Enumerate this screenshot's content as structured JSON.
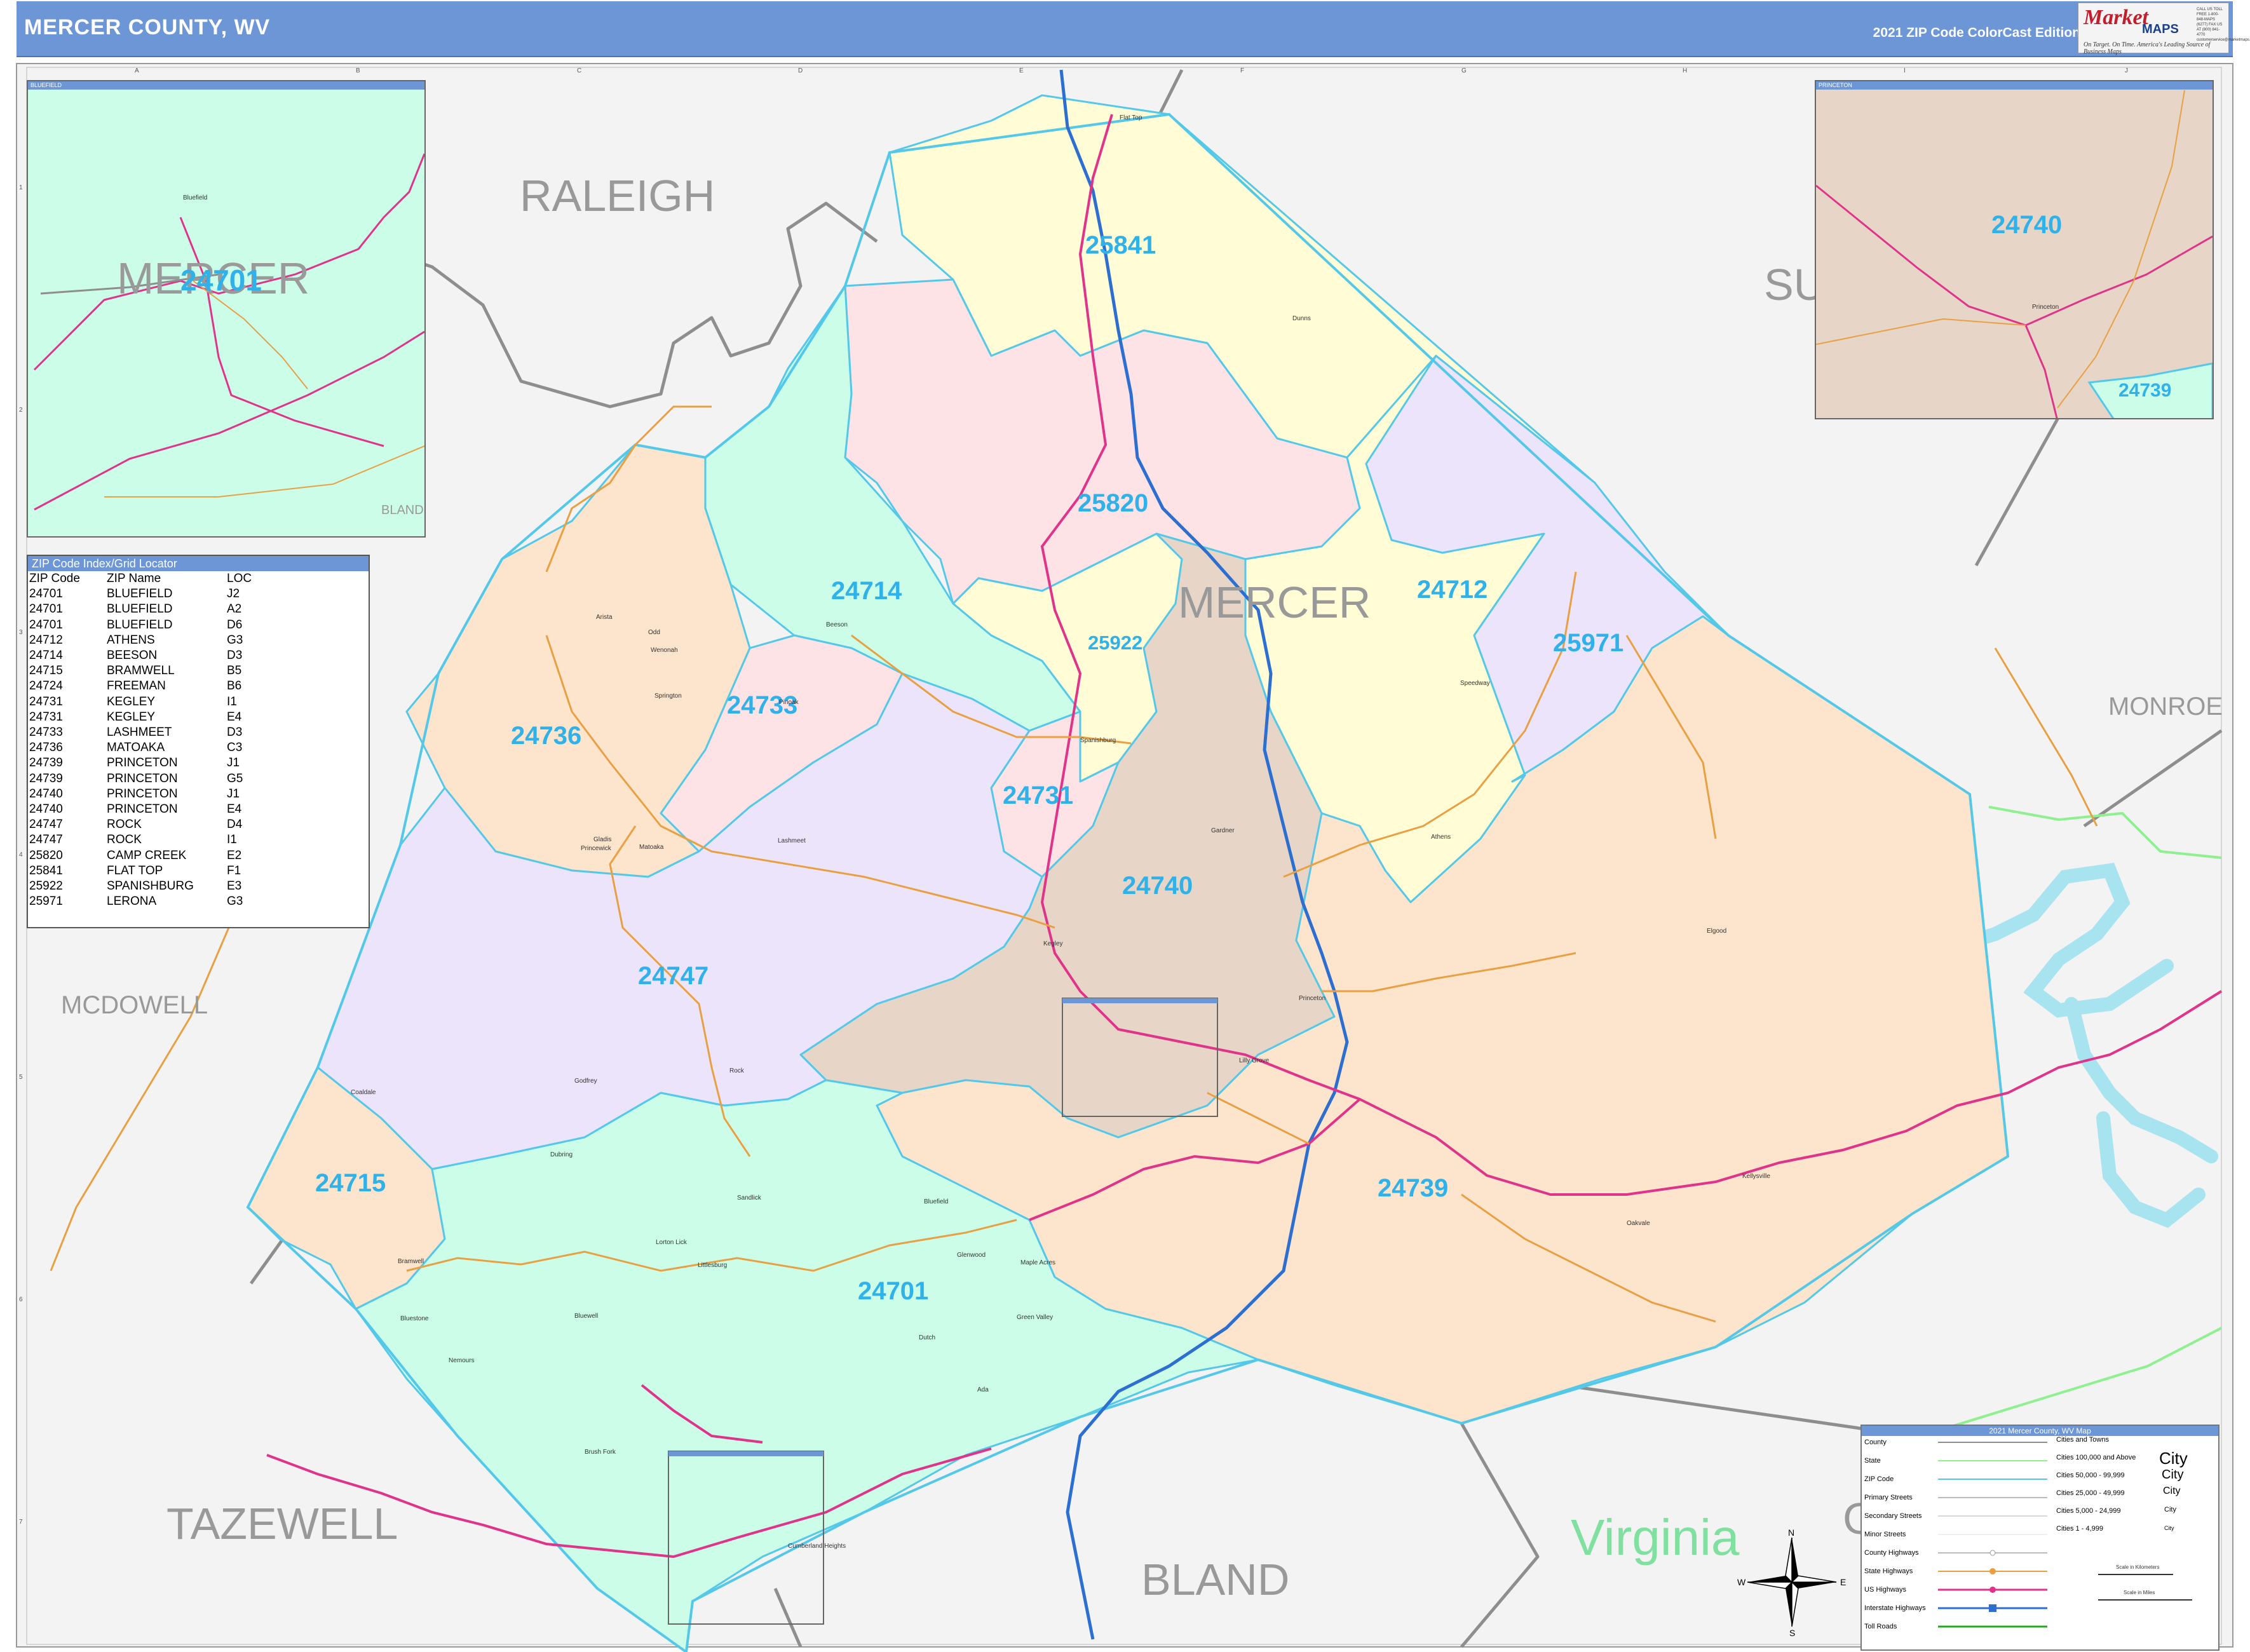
{
  "header": {
    "title": "MERCER COUNTY, WV",
    "edition": "2021 ZIP Code ColorCast Edition"
  },
  "logo": {
    "brand_market": "Market",
    "brand_maps": "MAPS",
    "tagline": "On Target. On Time. America's Leading Source of Business Maps",
    "contact": "CALL US TOLL FREE 1-800-848-MAPS (6277) FAX US AT (800) 841-4770 customerservice@marketmaps.com"
  },
  "colors": {
    "zip_label": "#2fb1ea",
    "zip_boundary": "#54c8e8",
    "county_boundary": "#8e8e8e",
    "us_highway": "#e0338a",
    "interstate": "#2c6fd0",
    "state_highway": "#e8a043",
    "water": "#a8e4f0",
    "virginia_label": "#7fe0a0"
  },
  "counties": {
    "raleigh": "RALEIGH",
    "summers": "SU",
    "monroe": "MONROE",
    "mcdowell": "MCDOWELL",
    "tazewell": "TAZEWELL",
    "bland": "BLAND",
    "giles": "G",
    "mercer": "MERCER",
    "virginia": "Virginia"
  },
  "zip_areas": [
    {
      "zip": "25841",
      "color": "#fffcd6"
    },
    {
      "zip": "25820",
      "color": "#fde2e6"
    },
    {
      "zip": "24714",
      "color": "#cbfde8"
    },
    {
      "zip": "24712",
      "color": "#fffcd6"
    },
    {
      "zip": "25971",
      "color": "#ece4fb"
    },
    {
      "zip": "25922",
      "color": "#fffcd6"
    },
    {
      "zip": "24733",
      "color": "#fde2e6"
    },
    {
      "zip": "24736",
      "color": "#fde4cc"
    },
    {
      "zip": "24731",
      "color": "#fde2e6"
    },
    {
      "zip": "24740",
      "color": "#e7d6c7"
    },
    {
      "zip": "24747",
      "color": "#ece4fb"
    },
    {
      "zip": "24715",
      "color": "#fde4cc"
    },
    {
      "zip": "24739",
      "color": "#fde4cc"
    },
    {
      "zip": "24701",
      "color": "#cbfde8"
    }
  ],
  "cities": [
    "Flat Top",
    "Dunns",
    "Beeson",
    "Odd",
    "Wenonah",
    "Springton",
    "Arista",
    "Pinoak",
    "Princewick",
    "Matoaka",
    "Gladis",
    "Spanishburg",
    "Speedway",
    "Athens",
    "Gardner",
    "Kegley",
    "Lashmeet",
    "Princeton",
    "Lilly Grove",
    "Elgood",
    "Rock",
    "Godfrey",
    "Oakvale",
    "Kellysville",
    "Coaldale",
    "Dubring",
    "Sandlick",
    "Nemours",
    "Lorton Lick",
    "Littlesburg",
    "Bramwell",
    "Bluestone",
    "Bluewell",
    "Glenwood",
    "Maple Acres",
    "Green Valley",
    "Ada",
    "Brush Fork",
    "Cumberland Heights",
    "Bluefield",
    "Dutch"
  ],
  "inset_bluefield": {
    "title": "BLUEFIELD",
    "zip": "24701",
    "county": "MERCER",
    "adjacent": "BLAND",
    "city": "Bluefield"
  },
  "inset_princeton": {
    "title": "PRINCETON",
    "zip_main": "24740",
    "zip_lower": "24739",
    "city": "Princeton"
  },
  "zip_index": {
    "title": "ZIP Code Index/Grid Locator",
    "columns": [
      "ZIP Code",
      "ZIP Name",
      "LOC"
    ],
    "rows": [
      [
        "24701",
        "BLUEFIELD",
        "J2"
      ],
      [
        "24701",
        "BLUEFIELD",
        "A2"
      ],
      [
        "24701",
        "BLUEFIELD",
        "D6"
      ],
      [
        "24712",
        "ATHENS",
        "G3"
      ],
      [
        "24714",
        "BEESON",
        "D3"
      ],
      [
        "24715",
        "BRAMWELL",
        "B5"
      ],
      [
        "24724",
        "FREEMAN",
        "B6"
      ],
      [
        "24731",
        "KEGLEY",
        "I1"
      ],
      [
        "24731",
        "KEGLEY",
        "E4"
      ],
      [
        "24733",
        "LASHMEET",
        "D3"
      ],
      [
        "24736",
        "MATOAKA",
        "C3"
      ],
      [
        "24739",
        "PRINCETON",
        "J1"
      ],
      [
        "24739",
        "PRINCETON",
        "G5"
      ],
      [
        "24740",
        "PRINCETON",
        "J1"
      ],
      [
        "24740",
        "PRINCETON",
        "E4"
      ],
      [
        "24747",
        "ROCK",
        "D4"
      ],
      [
        "24747",
        "ROCK",
        "I1"
      ],
      [
        "25820",
        "CAMP CREEK",
        "E2"
      ],
      [
        "25841",
        "FLAT TOP",
        "F1"
      ],
      [
        "25922",
        "SPANISHBURG",
        "E3"
      ],
      [
        "25971",
        "LERONA",
        "G3"
      ]
    ]
  },
  "legend": {
    "title": "2021 Mercer County, WV Map",
    "items": [
      "County",
      "State",
      "ZIP Code",
      "Primary Streets",
      "Secondary Streets",
      "Minor Streets",
      "County Highways",
      "State Highways",
      "US Highways",
      "Interstate Highways",
      "Toll Roads"
    ],
    "cities_title": "Cities and Towns",
    "city_classes": [
      "Cities 100,000 and Above",
      "Cities 50,000 - 99,999",
      "Cities 25,000 - 49,999",
      "Cities 5,000 - 24,999",
      "Cities 1 - 4,999"
    ],
    "city_samples": [
      "City",
      "City",
      "City",
      "City",
      "City"
    ],
    "scale_km": "Scale in Kilometers",
    "scale_mi": "Scale in Miles"
  },
  "compass": {
    "n": "N",
    "s": "S",
    "e": "E",
    "w": "W"
  },
  "grid": {
    "cols": [
      "A",
      "B",
      "C",
      "D",
      "E",
      "F",
      "G",
      "H",
      "I",
      "J"
    ],
    "rows": [
      "1",
      "2",
      "3",
      "4",
      "5",
      "6",
      "7"
    ]
  }
}
